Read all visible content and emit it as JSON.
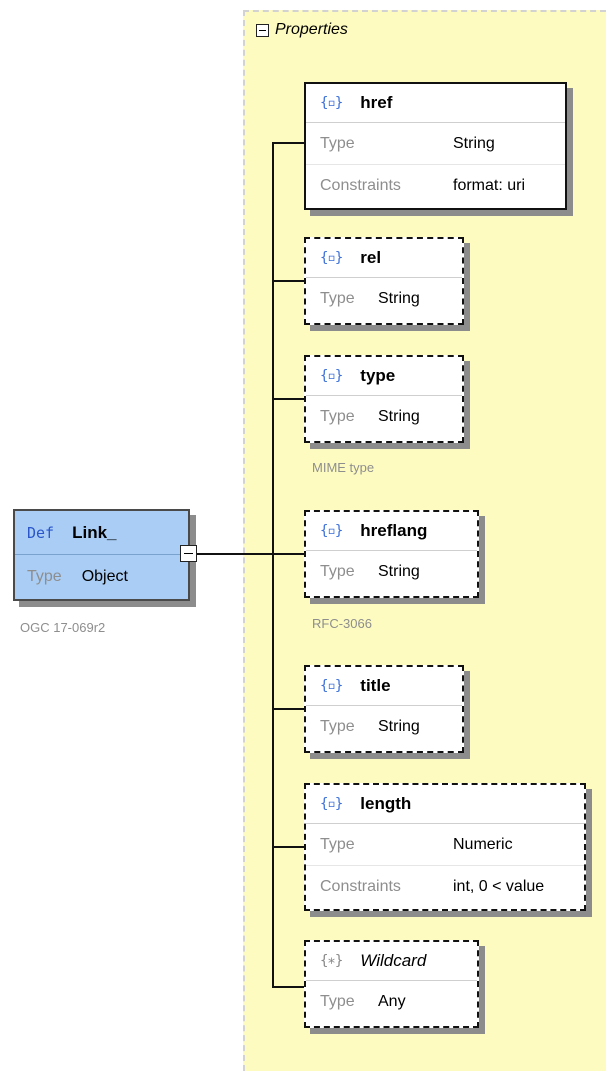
{
  "root": {
    "def_label": "Def",
    "name": "Link_",
    "type_label": "Type",
    "type_value": "Object",
    "note": "OGC 17-069r2"
  },
  "properties": {
    "title": "Properties",
    "items": [
      {
        "icon": "{▫}",
        "name": "href",
        "required": true,
        "rows": [
          {
            "key": "Type",
            "value": "String"
          },
          {
            "key": "Constraints",
            "value": "format: uri"
          }
        ],
        "note": ""
      },
      {
        "icon": "{▫}",
        "name": "rel",
        "required": false,
        "rows": [
          {
            "key": "Type",
            "value": "String"
          }
        ],
        "note": ""
      },
      {
        "icon": "{▫}",
        "name": "type",
        "required": false,
        "rows": [
          {
            "key": "Type",
            "value": "String"
          }
        ],
        "note": "MIME type"
      },
      {
        "icon": "{▫}",
        "name": "hreflang",
        "required": false,
        "rows": [
          {
            "key": "Type",
            "value": "String"
          }
        ],
        "note": "RFC-3066"
      },
      {
        "icon": "{▫}",
        "name": "title",
        "required": false,
        "rows": [
          {
            "key": "Type",
            "value": "String"
          }
        ],
        "note": ""
      },
      {
        "icon": "{▫}",
        "name": "length",
        "required": false,
        "rows": [
          {
            "key": "Type",
            "value": "Numeric"
          },
          {
            "key": "Constraints",
            "value": "int, 0 < value"
          }
        ],
        "note": ""
      },
      {
        "icon": "{∗}",
        "name": "Wildcard",
        "required": false,
        "rows": [
          {
            "key": "Type",
            "value": "Any"
          }
        ],
        "note": ""
      }
    ]
  },
  "colors": {
    "panel_background": "#fdfbc0",
    "root_background": "#a9cdf5",
    "def_label": "#2a56c9",
    "property_icon": "#3b6fd9"
  }
}
